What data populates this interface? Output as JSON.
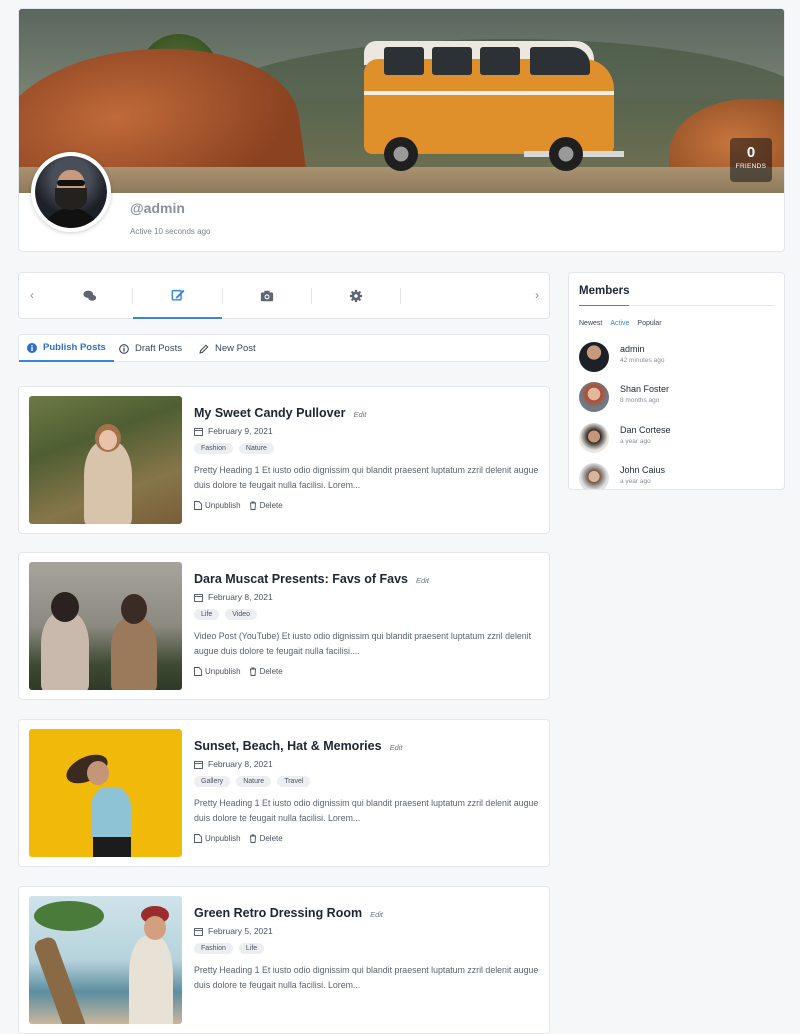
{
  "profile": {
    "handle": "@admin",
    "active": "Active 10 seconds ago",
    "friends_count": "0",
    "friends_label": "FRIENDS"
  },
  "icon_tabs": [
    {
      "icon": "chat-bubbles-icon"
    },
    {
      "icon": "edit-icon"
    },
    {
      "icon": "camera-icon"
    },
    {
      "icon": "gear-icon"
    }
  ],
  "sub_tabs": {
    "publish": "Publish Posts",
    "draft": "Draft Posts",
    "new": "New Post"
  },
  "posts": [
    {
      "title": "My Sweet Candy Pullover",
      "edit": "Edit",
      "date": "February 9, 2021",
      "tags": [
        "Fashion",
        "Nature"
      ],
      "excerpt": "Pretty Heading 1 Et iusto odio dignissim qui blandit praesent luptatum zzril delenit augue duis dolore te feugait nulla facilisi. Lorem...",
      "action1": "Unpublish",
      "action2": "Delete"
    },
    {
      "title": "Dara Muscat Presents: Favs of Favs",
      "edit": "Edit",
      "date": "February 8, 2021",
      "tags": [
        "Life",
        "Video"
      ],
      "excerpt": "Video Post (YouTube) Et iusto odio dignissim qui blandit praesent luptatum zzril delenit augue duis dolore te feugait nulla facilisi....",
      "action1": "Unpublish",
      "action2": "Delete"
    },
    {
      "title": "Sunset, Beach, Hat & Memories",
      "edit": "Edit",
      "date": "February 8, 2021",
      "tags": [
        "Gallery",
        "Nature",
        "Travel"
      ],
      "excerpt": "Pretty Heading 1 Et iusto odio dignissim qui blandit praesent luptatum zzril delenit augue duis dolore te feugait nulla facilisi. Lorem...",
      "action1": "Unpublish",
      "action2": "Delete"
    },
    {
      "title": "Green Retro Dressing Room",
      "edit": "Edit",
      "date": "February 5, 2021",
      "tags": [
        "Fashion",
        "Life"
      ],
      "excerpt": "Pretty Heading 1 Et iusto odio dignissim qui blandit praesent luptatum zzril delenit augue duis dolore te feugait nulla facilisi. Lorem...",
      "action1": "Unpublish",
      "action2": "Delete"
    }
  ],
  "members": {
    "title": "Members",
    "filters": [
      "Newest",
      "Active",
      "Popular"
    ],
    "active_filter": "Active",
    "list": [
      {
        "name": "admin",
        "time": "42 minutes ago"
      },
      {
        "name": "Shan Foster",
        "time": "8 months ago"
      },
      {
        "name": "Dan Cortese",
        "time": "a year ago"
      },
      {
        "name": "John Caius",
        "time": "a year ago"
      }
    ]
  },
  "colors": {
    "accent": "#3a84de",
    "van": "#e0902b",
    "thumb_yellow": "#f1b90a"
  }
}
